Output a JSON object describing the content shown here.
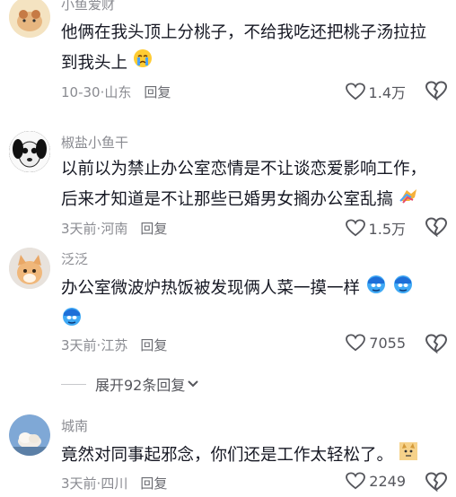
{
  "comments": [
    {
      "username": "小鱼爱财",
      "line1": "他俩在我头顶上分桃子，不给我吃还把桃子汤拉拉",
      "line2": "到我头上",
      "date": "10-30",
      "location": "山东",
      "reply": "回复",
      "likes": "1.4万"
    },
    {
      "username": "椒盐小鱼干",
      "line1": "以前以为禁止办公室恋情是不让谈恋爱影响工作，",
      "line2": "后来才知道是不让那些已婚男女搁办公室乱搞",
      "date": "3天前",
      "location": "河南",
      "reply": "回复",
      "likes": "1.5万"
    },
    {
      "username": "泛泛",
      "line1": "办公室微波炉热饭被发现俩人菜一摸一样",
      "date": "3天前",
      "location": "江苏",
      "reply": "回复",
      "likes": "7055"
    },
    {
      "username": "城南",
      "line1": "竟然对同事起邪念，你们还是工作太轻松了。",
      "date": "3天前",
      "location": "四川",
      "reply": "回复",
      "likes": "2249"
    }
  ],
  "expand_label": "展开92条回复",
  "separator": "·",
  "icons": {
    "like": "heart-outline-icon",
    "dislike": "broken-heart-icon",
    "expand": "chevron-down-icon"
  }
}
